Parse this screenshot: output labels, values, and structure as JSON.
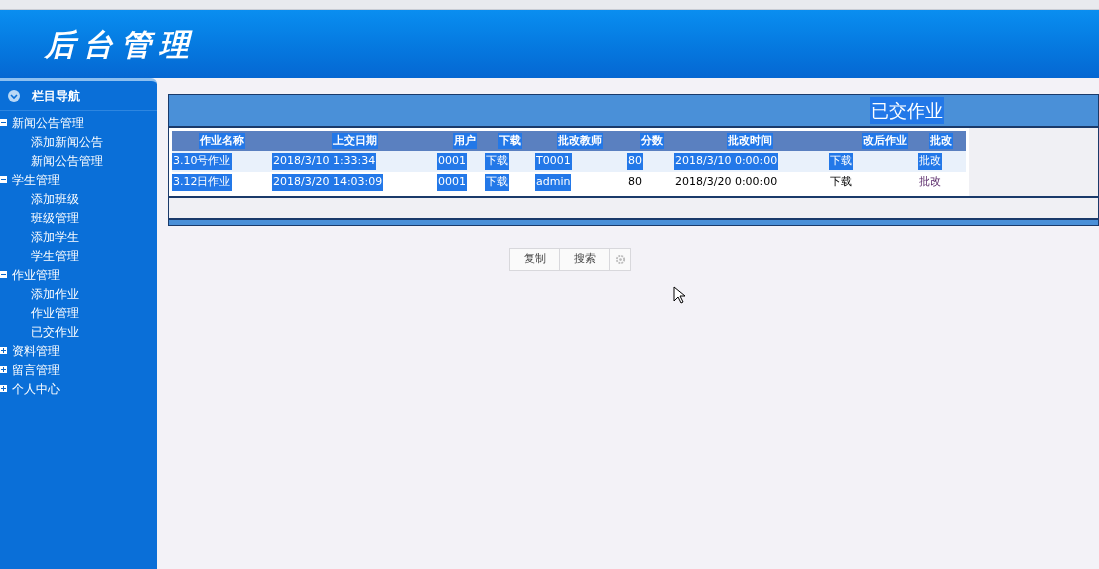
{
  "header": {
    "title": "后台管理"
  },
  "sidebar": {
    "title": "栏目导航",
    "items": [
      {
        "label": "新闻公告管理",
        "expanded": true,
        "children": [
          {
            "label": "添加新闻公告"
          },
          {
            "label": "新闻公告管理"
          }
        ]
      },
      {
        "label": "学生管理",
        "expanded": true,
        "children": [
          {
            "label": "添加班级"
          },
          {
            "label": "班级管理"
          },
          {
            "label": "添加学生"
          },
          {
            "label": "学生管理"
          }
        ]
      },
      {
        "label": "作业管理",
        "expanded": true,
        "children": [
          {
            "label": "添加作业"
          },
          {
            "label": "作业管理"
          },
          {
            "label": "已交作业"
          }
        ]
      },
      {
        "label": "资料管理",
        "expanded": false
      },
      {
        "label": "留言管理",
        "expanded": false
      },
      {
        "label": "个人中心",
        "expanded": false
      }
    ]
  },
  "panel": {
    "title": "已交作业",
    "title_selected": true
  },
  "table": {
    "columns": [
      {
        "label": "作业名称",
        "selected": true
      },
      {
        "label": "上交日期",
        "selected": true
      },
      {
        "label": "用户",
        "selected": true
      },
      {
        "label": "下载",
        "selected": true
      },
      {
        "label": "批改教师",
        "selected": true
      },
      {
        "label": "分数",
        "selected": true
      },
      {
        "label": "批改时间",
        "selected": true
      },
      {
        "label": "改后作业",
        "selected": true
      },
      {
        "label": "批改",
        "selected": true
      }
    ],
    "rows": [
      {
        "cells": [
          {
            "text": "3.10号作业",
            "selected": true
          },
          {
            "text": "2018/3/10 1:33:34",
            "selected": true
          },
          {
            "text": "0001",
            "selected": true
          },
          {
            "text": "下载",
            "selected": true
          },
          {
            "text": "T0001",
            "selected": true
          },
          {
            "text": "80",
            "selected": true
          },
          {
            "text": "2018/3/10 0:00:00",
            "selected": true
          },
          {
            "text": "下载",
            "selected": true
          },
          {
            "text": "批改",
            "selected": true
          }
        ]
      },
      {
        "cells": [
          {
            "text": "3.12日作业",
            "selected": true
          },
          {
            "text": "2018/3/20 14:03:09",
            "selected": true
          },
          {
            "text": "0001",
            "selected": true
          },
          {
            "text": "下载",
            "selected": true
          },
          {
            "text": "admin",
            "selected": true
          },
          {
            "text": "80",
            "selected": false
          },
          {
            "text": "2018/3/20 0:00:00",
            "selected": false
          },
          {
            "text": "下载",
            "selected": false
          },
          {
            "text": "批改",
            "selected": false
          }
        ]
      }
    ]
  },
  "toolbar": {
    "buttons": [
      "复制",
      "搜索"
    ]
  }
}
